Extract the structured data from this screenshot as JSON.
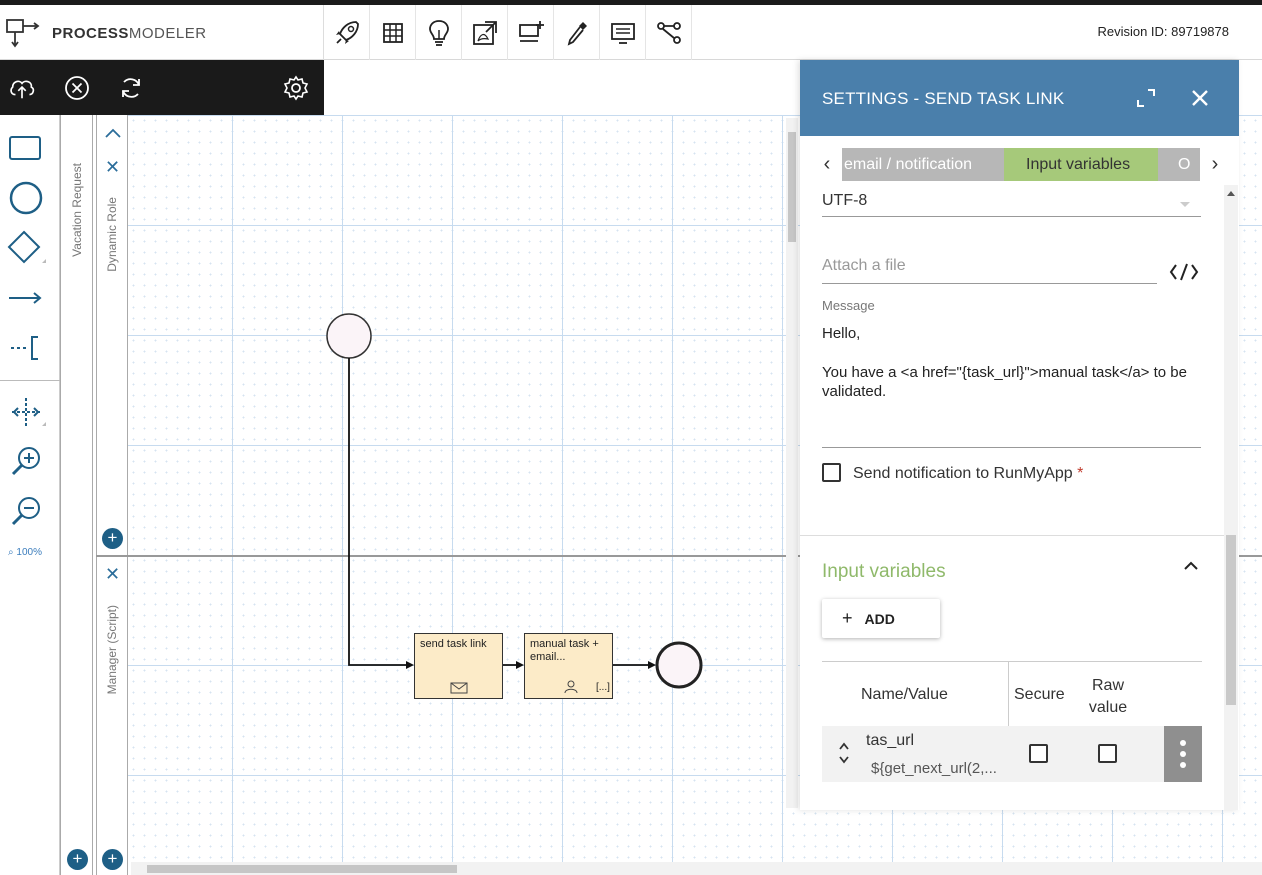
{
  "header": {
    "logo_bold": "PROCESS",
    "logo_light": "MODELER",
    "revision": "Revision ID: 89719878",
    "tools": [
      "rocket-icon",
      "grid-icon",
      "lightbulb-icon",
      "pdf-export-icon",
      "add-lane-icon",
      "eyedropper-icon",
      "list-icon",
      "workflow-icon"
    ]
  },
  "darkbar": {
    "icons": [
      "cloud-upload-icon",
      "close-circle-icon",
      "refresh-icon",
      "settings-icon"
    ]
  },
  "palette": {
    "zoom": "100%"
  },
  "diagram": {
    "pool_label": "Vacation Request",
    "lane1_label": "Dynamic Role",
    "lane2_label": "Manager (Script)",
    "task1": "send task link",
    "task2": "manual task + email...",
    "task2_marker": "[...]"
  },
  "panel": {
    "title": "SETTINGS  - SEND TASK LINK",
    "tabs": {
      "email": "email / notification",
      "input": "Input variables",
      "out": "O"
    },
    "encoding_value": "UTF-8",
    "attach_placeholder": "Attach a file",
    "message_label": "Message",
    "message_line1": "Hello,",
    "message_line2": "You have a <a href=\"{task_url}\">manual task</a> to be validated.",
    "notify_label": "Send notification to RunMyApp",
    "required_mark": "*",
    "input_vars_title": "Input variables",
    "add_label": "ADD",
    "table": {
      "col_name": "Name/Value",
      "col_secure": "Secure",
      "col_raw": "Raw value",
      "rows": [
        {
          "name": "tas_url",
          "value": "${get_next_url(2,..."
        }
      ]
    }
  },
  "colors": {
    "panel_header": "#4a7fab",
    "tab_active": "#a6c97a",
    "tab_inactive": "#b7b7b7",
    "task_fill": "#fcebc8",
    "accent_green": "#8fb96a",
    "accent_blue": "#1e5f86"
  }
}
